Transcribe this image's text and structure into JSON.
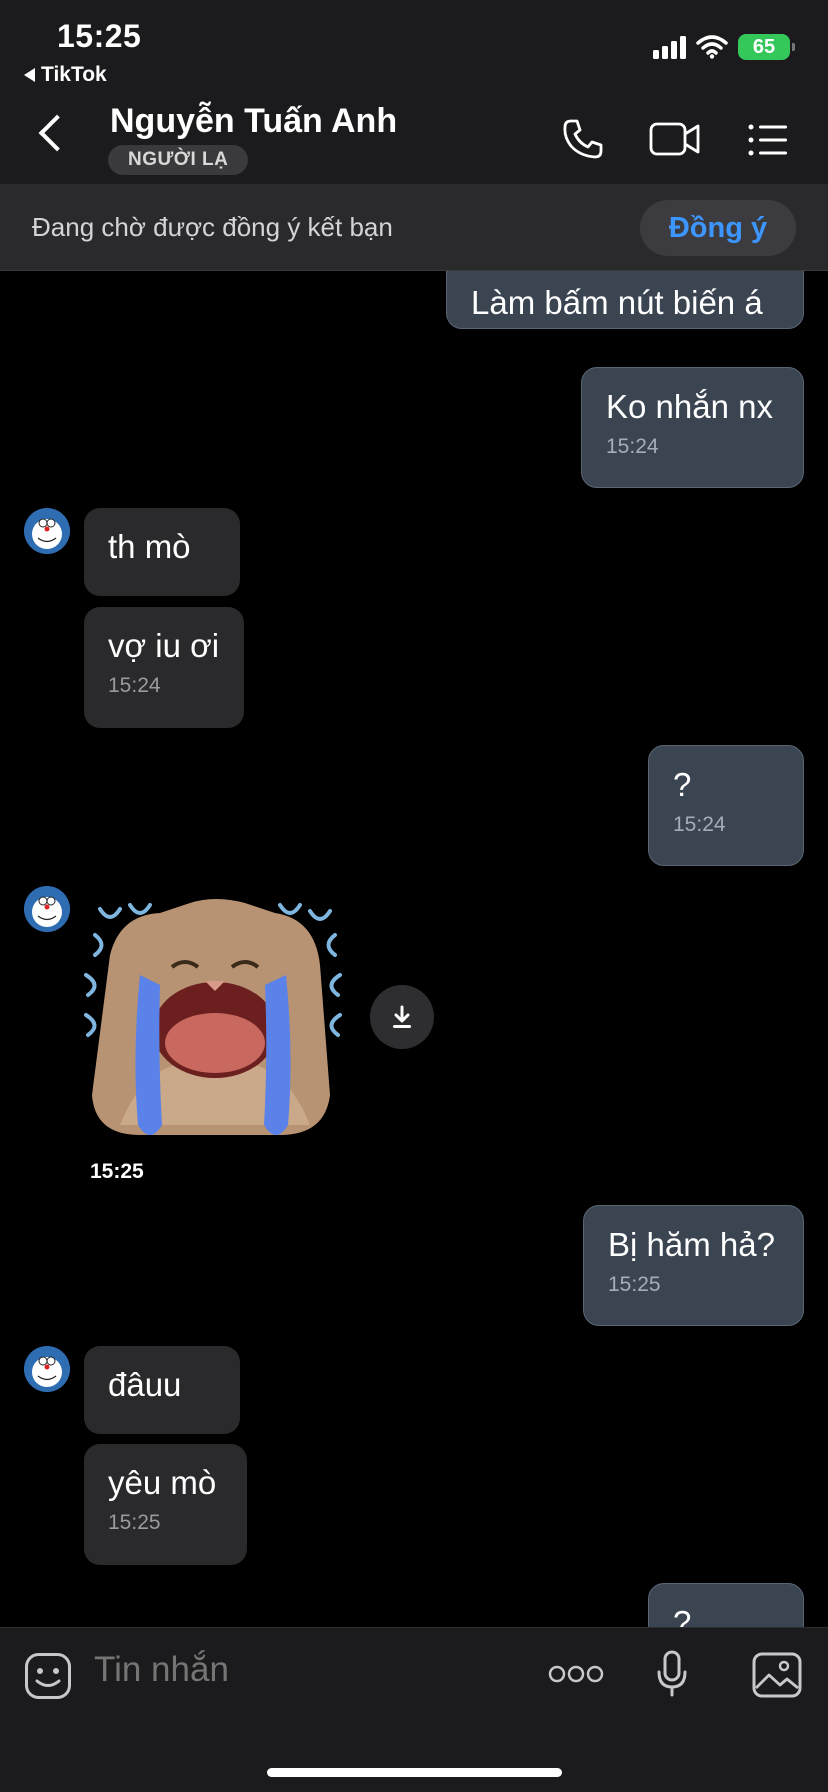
{
  "status_bar": {
    "time": "15:25",
    "back_app": "TikTok",
    "battery": "65"
  },
  "header": {
    "contact_name": "Nguyễn Tuấn Anh",
    "badge": "NGƯỜI LẠ"
  },
  "pending_bar": {
    "text": "Đang chờ được đồng ý kết bạn",
    "accept_label": "Đồng ý"
  },
  "messages": [
    {
      "dir": "out",
      "text": "Làm bấm nút biến á",
      "time": ""
    },
    {
      "dir": "out",
      "text": "Ko nhắn nx",
      "time": "15:24"
    },
    {
      "dir": "in",
      "text": "th mò",
      "time": ""
    },
    {
      "dir": "in",
      "text": "vợ iu ơi",
      "time": "15:24"
    },
    {
      "dir": "out",
      "text": "?",
      "time": "15:24"
    },
    {
      "dir": "in",
      "type": "sticker",
      "time": "15:25"
    },
    {
      "dir": "out",
      "text": "Bị hăm hả?",
      "time": "15:25"
    },
    {
      "dir": "in",
      "text": "đâuu",
      "time": ""
    },
    {
      "dir": "in",
      "text": "yêu mò",
      "time": "15:25"
    },
    {
      "dir": "out",
      "text": "?",
      "time": ""
    }
  ],
  "composer": {
    "placeholder": "Tin nhắn"
  },
  "colors": {
    "accent": "#3d96ff",
    "outgoing_bubble": "#3b4552",
    "incoming_bubble": "#2a2a2c",
    "battery": "#34c759"
  }
}
